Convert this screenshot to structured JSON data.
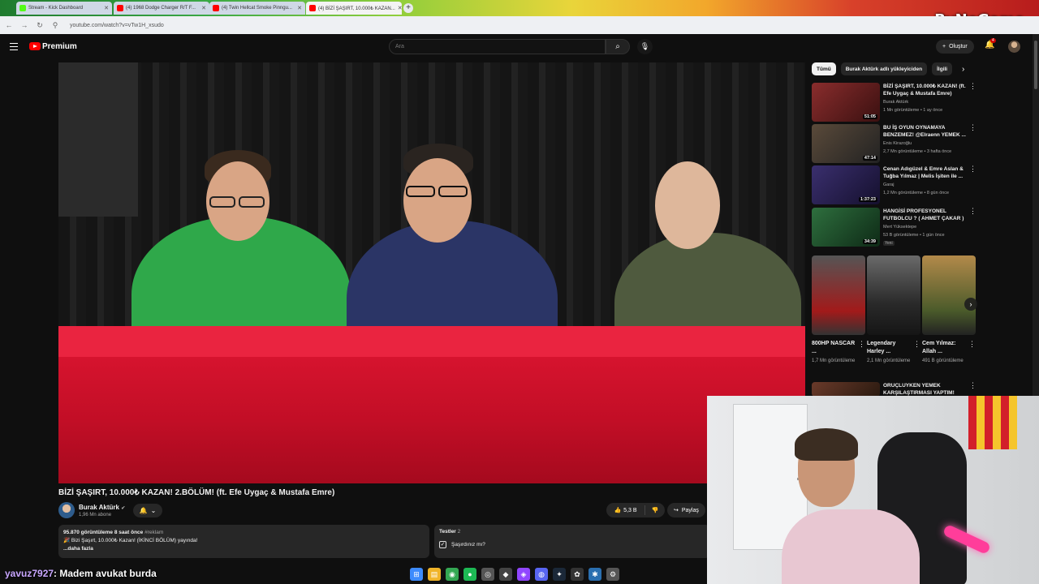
{
  "browser": {
    "tabs": [
      {
        "label": "Stream - Kick Dashboard",
        "color": "#53fc18",
        "active": false
      },
      {
        "label": "(4) 1968 Dodge Charger R/T F...",
        "color": "#ff0000",
        "active": false
      },
      {
        "label": "(4) Twin Hellcat Smoke Pinngu...",
        "color": "#ff0000",
        "active": false
      },
      {
        "label": "(4) BİZİ ŞAŞIRT, 10.000₺ KAZAN...",
        "color": "#ff0000",
        "active": true
      }
    ],
    "new_tab": "+",
    "url": "youtube.com/watch?v=vTw1H_xsudo",
    "watermark": "ByNoGame"
  },
  "youtube": {
    "logo_text": "Premium",
    "search_placeholder": "Ara",
    "create_label": "Oluştur",
    "notifications_count": "4"
  },
  "video": {
    "title": "BİZİ ŞAŞIRT, 10.000₺ KAZAN! 2.BÖLÜM! (ft. Efe Uygaç & Mustafa Emre)",
    "channel": "Burak Aktürk",
    "subscribers": "1,96 Mn abone",
    "likes": "5,3 B",
    "share_label": "Paylaş",
    "description": {
      "views": "95.870 görüntüleme",
      "age": "8 saat önce",
      "tag": "#reklam",
      "line": "Bizi Şaşırt, 10.000₺ Kazan! (İKİNCİ BÖLÜM) yayında!",
      "more": "...daha fazla"
    },
    "quiz": {
      "label": "Testler",
      "count": "2",
      "question": "Şaşırdınız mı?"
    }
  },
  "sidebar": {
    "chips": [
      "Tümü",
      "Burak Aktürk adlı yükleyiciden",
      "İlgili"
    ],
    "recommendations": [
      {
        "title": "BİZİ ŞAŞIRT, 10.000₺ KAZAN! (ft. Efe Uygaç & Mustafa Emre)",
        "channel": "Burak Aktürk",
        "meta": "1 Mn görüntüleme • 1 ay önce",
        "duration": "51:05",
        "color": "#8a2d2d"
      },
      {
        "title": "BU İŞ OYUN OYNAMAYA BENZEMEZ! @Elraenn YEMEK ...",
        "channel": "Enis Kirazoğlu",
        "meta": "2,7 Mn görüntüleme • 3 hafta önce",
        "duration": "47:14",
        "color": "#5a4a3a"
      },
      {
        "title": "Cenan Adıgüzel & Emre Aslan & Tuğba Yılmaz | Melis İşiten ile ...",
        "channel": "Garaj",
        "meta": "1,2 Mn görüntüleme • 8 gün önce",
        "duration": "1:37:23",
        "color": "#3a2f6e"
      },
      {
        "title": "HANGİSİ PROFESYONEL FUTBOLCU ? ( AHMET ÇAKAR )",
        "channel": "Mert Yüksektepe",
        "meta": "53 B görüntüleme • 1 gün önce",
        "duration": "34:39",
        "badge": "Yeni",
        "color": "#2e6f3e"
      }
    ],
    "shorts": [
      {
        "title": "800HP NASCAR ...",
        "views": "1,7 Mn görüntüleme",
        "color": "#a21a1a"
      },
      {
        "title": "Legendary Harley ...",
        "views": "2,1 Mn görüntüleme",
        "color": "#3a3a3a"
      },
      {
        "title": "Cem Yılmaz: Allah ...",
        "views": "491 B görüntüleme",
        "color": "#7a5a2a"
      }
    ],
    "next_rec": {
      "title": "ORUÇLUYKEN YEMEK KARŞILAŞTIRMASI YAPTIM!",
      "color": "#6a3a2a"
    }
  },
  "chat": {
    "user": "yavuz7927",
    "message": ": Madem avukat burda"
  },
  "taskbar": [
    {
      "name": "windows-start-icon",
      "glyph": "⊞",
      "color": "#3d8bfd"
    },
    {
      "name": "file-explorer-icon",
      "glyph": "▤",
      "color": "#f0b429"
    },
    {
      "name": "chrome-icon",
      "glyph": "◉",
      "color": "#34a853"
    },
    {
      "name": "spotify-icon",
      "glyph": "●",
      "color": "#1db954"
    },
    {
      "name": "obs-icon",
      "glyph": "◎",
      "color": "#555555"
    },
    {
      "name": "epic-icon",
      "glyph": "◆",
      "color": "#444444"
    },
    {
      "name": "twitch-icon",
      "glyph": "◈",
      "color": "#9146ff"
    },
    {
      "name": "discord-icon",
      "glyph": "◍",
      "color": "#5865f2"
    },
    {
      "name": "steam-icon",
      "glyph": "✦",
      "color": "#1b2838"
    },
    {
      "name": "app-icon",
      "glyph": "✿",
      "color": "#333333"
    },
    {
      "name": "settings-icon",
      "glyph": "✱",
      "color": "#2a6fb0"
    },
    {
      "name": "gear-icon",
      "glyph": "⚙",
      "color": "#555555"
    }
  ]
}
